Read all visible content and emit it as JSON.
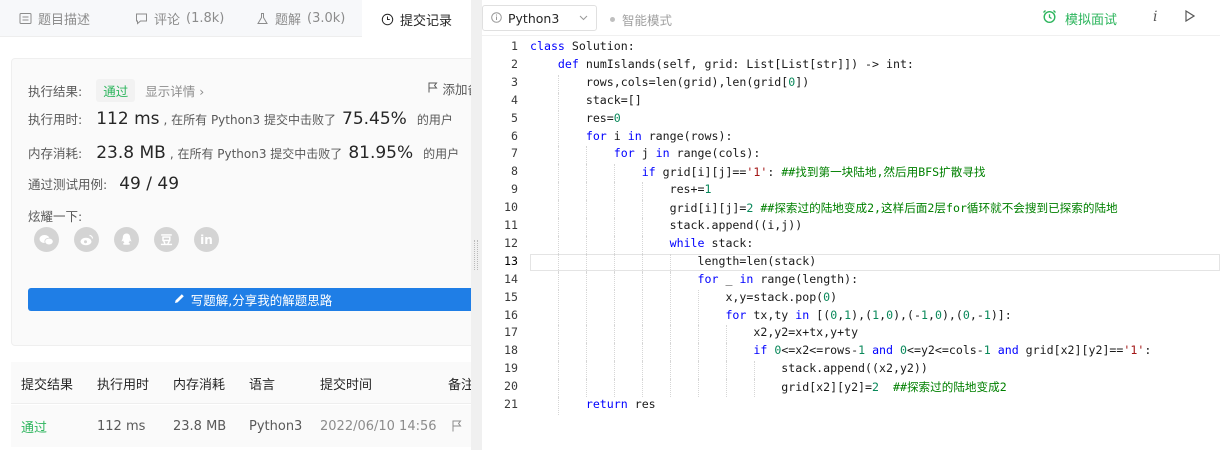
{
  "tabs": [
    {
      "label": "题目描述",
      "count": "",
      "icon": "doc-icon"
    },
    {
      "label": "评论",
      "count": "(1.8k)",
      "icon": "comment-icon"
    },
    {
      "label": "题解",
      "count": "(3.0k)",
      "icon": "flask-icon"
    },
    {
      "label": "提交记录",
      "count": "",
      "icon": "clock-icon"
    }
  ],
  "result": {
    "label": "执行结果:",
    "status": "通过",
    "detail": "显示详情 ›",
    "add_note": "添加备",
    "time_label": "执行用时:",
    "time_value": "112 ms",
    "time_mid": ", 在所有 Python3 提交中击败了",
    "time_pct": "75.45%",
    "suffix": "的用户",
    "mem_label": "内存消耗:",
    "mem_value": "23.8 MB",
    "mem_mid": ", 在所有 Python3 提交中击败了",
    "mem_pct": "81.95%",
    "tests_label": "通过测试用例:",
    "tests_value": "49 / 49",
    "share_label": "炫耀一下:",
    "share_icons": [
      "wechat-icon",
      "weibo-icon",
      "qq-icon",
      "douban-icon",
      "linkedin-icon"
    ],
    "douban_char": "豆",
    "linkedin_text": "in",
    "write_btn": "写题解,分享我的解题思路"
  },
  "table": {
    "headers": [
      "提交结果",
      "执行用时",
      "内存消耗",
      "语言",
      "提交时间",
      "备注"
    ],
    "row": [
      "通过",
      "112 ms",
      "23.8 MB",
      "Python3",
      "2022/06/10 14:56"
    ]
  },
  "toolbar": {
    "language": "Python3",
    "smart_mode": "智能模式",
    "mock_interview": "模拟面试",
    "info": "i"
  },
  "editor": {
    "current_line": 13,
    "lines": [
      "class Solution:",
      "    def numIslands(self, grid: List[List[str]]) -> int:",
      "        rows,cols=len(grid),len(grid[0])",
      "        stack=[]",
      "        res=0",
      "        for i in range(rows):",
      "            for j in range(cols):",
      "                if grid[i][j]=='1': ##找到第一块陆地,然后用BFS扩散寻找",
      "                    res+=1",
      "                    grid[i][j]=2 ##探索过的陆地变成2,这样后面2层for循环就不会搜到已探索的陆地",
      "                    stack.append((i,j))",
      "                    while stack:",
      "                        length=len(stack)",
      "                        for _ in range(length):",
      "                            x,y=stack.pop(0)",
      "                            for tx,ty in [(0,1),(1,0),(-1,0),(0,-1)]:",
      "                                x2,y2=x+tx,y+ty",
      "                                if 0<=x2<=rows-1 and 0<=y2<=cols-1 and grid[x2][y2]=='1':",
      "                                    stack.append((x2,y2))",
      "                                    grid[x2][y2]=2  ##探索过的陆地变成2",
      "        return res"
    ]
  },
  "colors": {
    "accent_green": "#2db55d",
    "button_blue": "#1f7ee6",
    "keyword": "#0000ff",
    "number": "#09885a",
    "string": "#a31515",
    "comment": "#008000"
  }
}
